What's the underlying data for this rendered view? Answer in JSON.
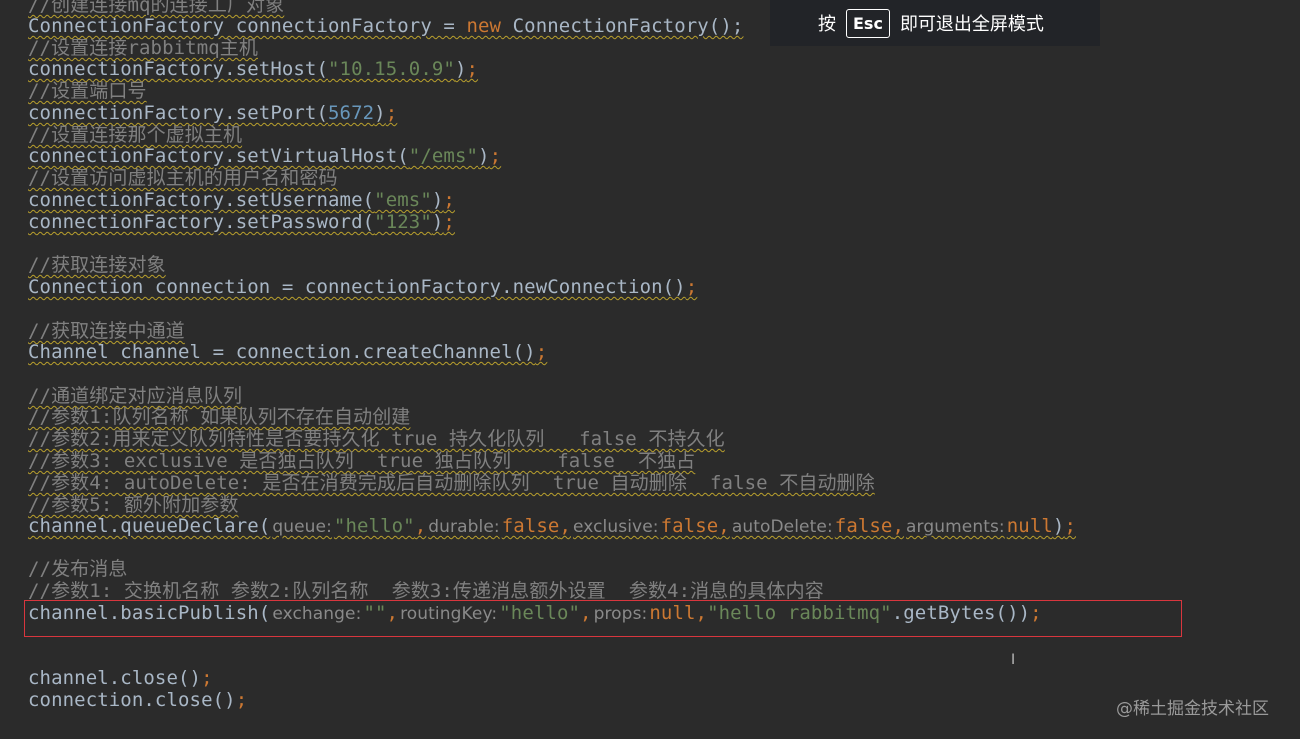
{
  "esc_tip": {
    "prefix": "按",
    "key": "Esc",
    "suffix": "即可退出全屏模式"
  },
  "watermark": "@稀土掘金技术社区",
  "cursor_glyph": "I",
  "code": {
    "l0": "//创建连接mq的连接工厂对象",
    "l1a": "ConnectionFactory connectionFactory = ",
    "l1b": "new",
    "l1c": " ConnectionFactory();",
    "l2": "//设置连接rabbitmq主机",
    "l3a": "connectionFactory.setHost(",
    "l3b": "\"10.15.0.9\"",
    "l3c": ")",
    "l3d": ";",
    "l4": "//设置端口号",
    "l5a": "connectionFactory.setPort(",
    "l5b": "5672",
    "l5c": ")",
    "l5d": ";",
    "l6": "//设置连接那个虚拟主机",
    "l7a": "connectionFactory.setVirtualHost(",
    "l7b": "\"/ems\"",
    "l7c": ")",
    "l7d": ";",
    "l8": "//设置访问虚拟主机的用户名和密码",
    "l9a": "connectionFactory.setUsername(",
    "l9b": "\"ems\"",
    "l9c": ")",
    "l9d": ";",
    "l10a": "connectionFactory.setPassword(",
    "l10b": "\"123\"",
    "l10c": ")",
    "l10d": ";",
    "l11": "//获取连接对象",
    "l12a": "Connection connection = connectionFactory.newConnection()",
    "l12b": ";",
    "l13": "//获取连接中通道",
    "l14a": "Channel channel = connection.createChannel()",
    "l14b": ";",
    "l15": "//通道绑定对应消息队列",
    "l16": "//参数1:队列名称 如果队列不存在自动创建",
    "l17": "//参数2:用来定义队列特性是否要持久化 true 持久化队列   false 不持久化",
    "l18": "//参数3: exclusive 是否独占队列  true 独占队列    false  不独占",
    "l19": "//参数4: autoDelete: 是否在消费完成后自动删除队列  true 自动删除  false 不自动删除",
    "l20": "//参数5: 额外附加参数",
    "l21a": "channel.queueDeclare(",
    "l21h1": "queue:",
    "l21v1": "\"hello\"",
    "l21s1": ",",
    "l21h2": "durable:",
    "l21v2": "false",
    "l21s2": ",",
    "l21h3": "exclusive:",
    "l21v3": "false",
    "l21s3": ",",
    "l21h4": "autoDelete:",
    "l21v4": "false",
    "l21s4": ",",
    "l21h5": "arguments:",
    "l21v5": "null",
    "l21c": ")",
    "l21d": ";",
    "l22": "//发布消息",
    "l23": "//参数1: 交换机名称 参数2:队列名称  参数3:传递消息额外设置  参数4:消息的具体内容",
    "l24a": "channel.basicPublish(",
    "l24h1": "exchange:",
    "l24v1": "\"\"",
    "l24s1": ",",
    "l24h2": "routingKey:",
    "l24v2": "\"hello\"",
    "l24s2": ",",
    "l24h3": "props:",
    "l24v3": "null",
    "l24s3": ",",
    "l24v4": "\"hello rabbitmq\"",
    "l24c": ".getBytes())",
    "l24d": ";",
    "l25a": "channel.close()",
    "l25b": ";",
    "l26a": "connection.close()",
    "l26b": ";"
  }
}
